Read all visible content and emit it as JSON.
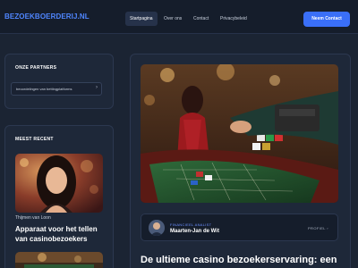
{
  "header": {
    "logo": "BEZOEKBOERDERIJ.NL",
    "nav": [
      {
        "label": "Startpagina",
        "active": true
      },
      {
        "label": "Over ons",
        "active": false
      },
      {
        "label": "Contact",
        "active": false
      },
      {
        "label": "Privacybeleid",
        "active": false
      }
    ],
    "cta_label": "Neem Contact"
  },
  "sidebar": {
    "partners_title": "ONZE PARTNERS",
    "partner_link": "beoordelingen van bettingplatforms",
    "recent_title": "MEEST RECENT",
    "recent_post": {
      "author": "Thijmen van Loon",
      "title": "Apparaat voor het tellen van casinobezoekers"
    }
  },
  "main": {
    "author_role": "FINANCIEEL ANALIST",
    "author_name": "Maarten-Jan de Wit",
    "profile_label": "PROFIEL ›",
    "article_title": "De ultieme casino bezoekerservaring: een"
  },
  "colors": {
    "background": "#1b2433",
    "panel": "#1e2839",
    "accent": "#3a6ff8",
    "logo": "#4f86ff"
  }
}
